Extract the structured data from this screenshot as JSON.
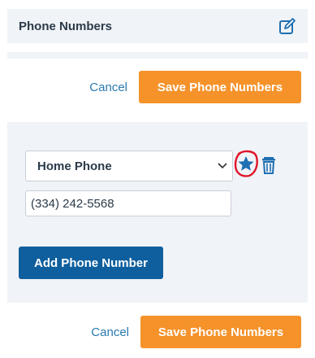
{
  "section": {
    "title": "Phone Numbers",
    "edit_icon": "edit-square-icon"
  },
  "actions_top": {
    "cancel_label": "Cancel",
    "save_label": "Save Phone Numbers"
  },
  "phone_entry": {
    "type_value": "Home Phone",
    "number_value": "(334) 242-5568",
    "primary_icon": "star-icon",
    "delete_icon": "trash-icon",
    "chevron_icon": "chevron-down-icon"
  },
  "add_button_label": "Add Phone Number",
  "actions_bottom": {
    "cancel_label": "Cancel",
    "save_label": "Save Phone Numbers"
  },
  "colors": {
    "accent_orange": "#f5922a",
    "primary_blue": "#0f5f9e",
    "link_blue": "#2a7ab0",
    "panel_bg": "#f0f3f7",
    "highlight_red": "#e0152b"
  }
}
